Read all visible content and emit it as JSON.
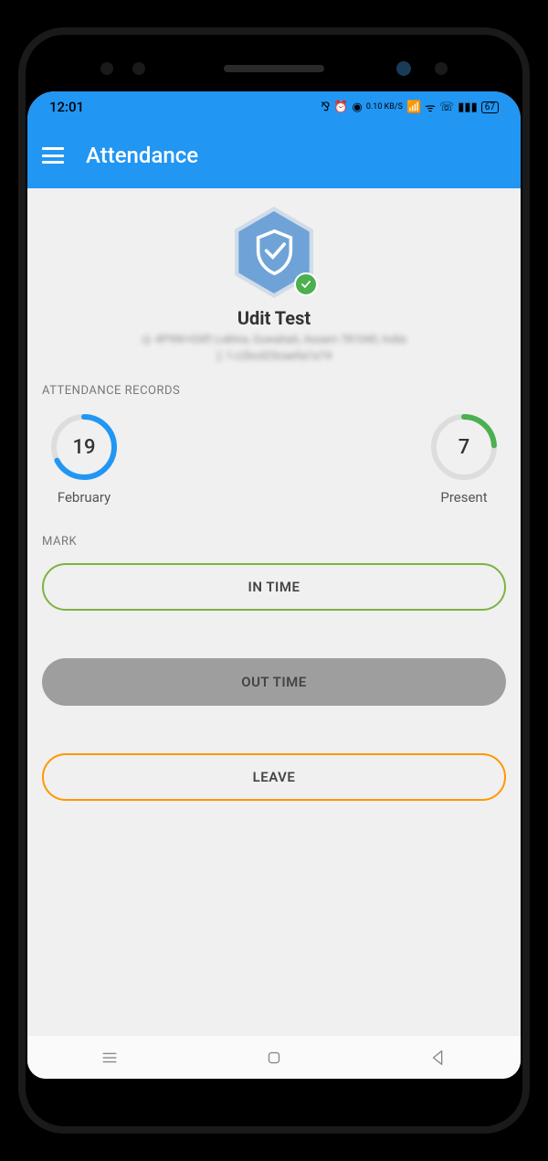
{
  "status": {
    "time": "12:01",
    "data_rate": "0.10 KB/S",
    "battery": "67"
  },
  "header": {
    "title": "Attendance"
  },
  "profile": {
    "name": "Udit Test",
    "location": "4P9W+GXP, Lokhra, Guwahati, Assam 781040, India",
    "device": "1-c2bcd25caa9a1e74"
  },
  "records": {
    "section_label": "Attendance Records",
    "date_value": "19",
    "date_label": "February",
    "present_value": "7",
    "present_label": "Present"
  },
  "mark": {
    "section_label": "Mark",
    "in_time": "IN TIME",
    "out_time": "OUT TIME",
    "leave": "LEAVE"
  }
}
